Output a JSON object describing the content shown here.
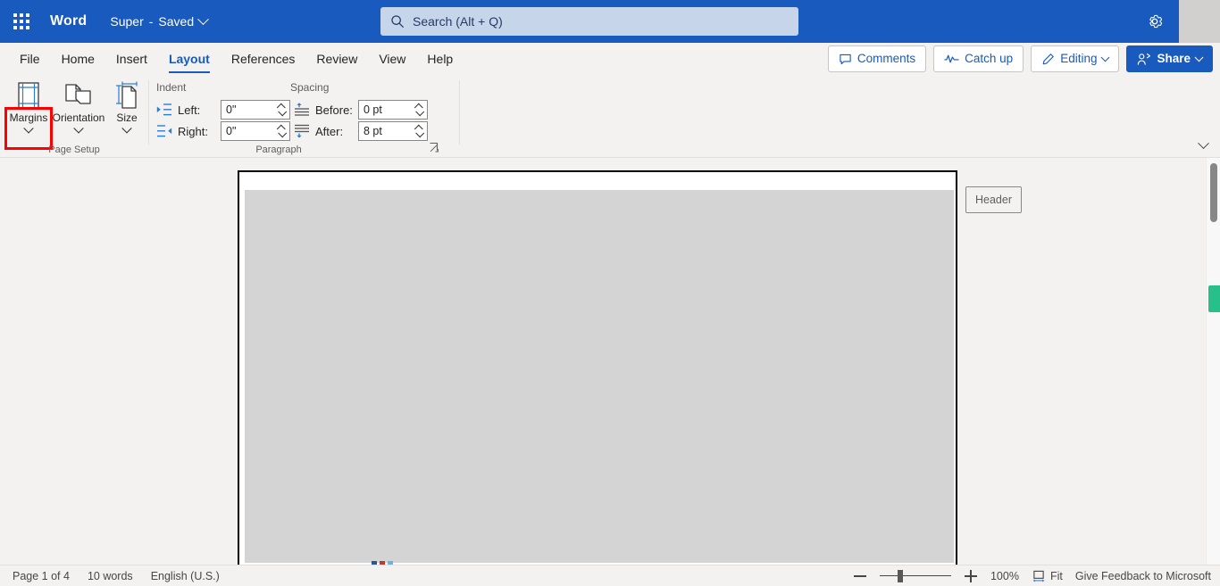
{
  "titlebar": {
    "app_launcher_icon": "waffle-grid-icon",
    "app_name": "Word",
    "document_name": "Super",
    "separator": "-",
    "save_state": "Saved",
    "settings_icon": "gear-icon",
    "brand_color": "#185abd"
  },
  "search": {
    "icon": "search-icon",
    "placeholder": "Search (Alt + Q)"
  },
  "tabs": [
    {
      "label": "File",
      "active": false
    },
    {
      "label": "Home",
      "active": false
    },
    {
      "label": "Insert",
      "active": false
    },
    {
      "label": "Layout",
      "active": true
    },
    {
      "label": "References",
      "active": false
    },
    {
      "label": "Review",
      "active": false
    },
    {
      "label": "View",
      "active": false
    },
    {
      "label": "Help",
      "active": false
    }
  ],
  "tab_actions": {
    "comments": {
      "label": "Comments",
      "icon": "comment-bubble-icon"
    },
    "catch_up": {
      "label": "Catch up",
      "icon": "activity-line-icon"
    },
    "editing": {
      "label": "Editing",
      "icon": "pencil-icon",
      "caret": "chevron-down-icon"
    },
    "share": {
      "label": "Share",
      "icon": "person-share-icon",
      "caret": "chevron-down-icon"
    }
  },
  "ribbon": {
    "page_setup": {
      "group_label": "Page Setup",
      "buttons": [
        {
          "label": "Margins",
          "icon": "margins-icon",
          "caret": "chevron-down-icon",
          "highlighted": true
        },
        {
          "label": "Orientation",
          "icon": "orientation-icon",
          "caret": "chevron-down-icon",
          "highlighted": false
        },
        {
          "label": "Size",
          "icon": "page-size-icon",
          "caret": "chevron-down-icon",
          "highlighted": false
        }
      ]
    },
    "paragraph": {
      "group_label": "Paragraph",
      "indent_label": "Indent",
      "spacing_label": "Spacing",
      "fields": [
        {
          "label": "Left:",
          "value": "0\"",
          "icon": "indent-left-icon"
        },
        {
          "label": "Right:",
          "value": "0\"",
          "icon": "indent-right-icon"
        },
        {
          "label": "Before:",
          "value": "0 pt",
          "icon": "spacing-before-icon"
        },
        {
          "label": "After:",
          "value": "8 pt",
          "icon": "spacing-after-icon"
        }
      ],
      "dialog_launcher_icon": "dialog-launcher-icon"
    },
    "collapse_icon": "chevron-down-icon",
    "highlight_color": "#ff0000"
  },
  "document": {
    "header_tag_label": "Header",
    "collaborator_marker_color": "#27c08b"
  },
  "statusbar": {
    "page_info": "Page 1 of 4",
    "word_count": "10 words",
    "language": "English (U.S.)",
    "zoom_out_icon": "minus-icon",
    "zoom_in_icon": "plus-icon",
    "zoom_level": "100%",
    "fit_label": "Fit",
    "fit_icon": "fit-page-icon",
    "feedback": "Give Feedback to Microsoft"
  }
}
